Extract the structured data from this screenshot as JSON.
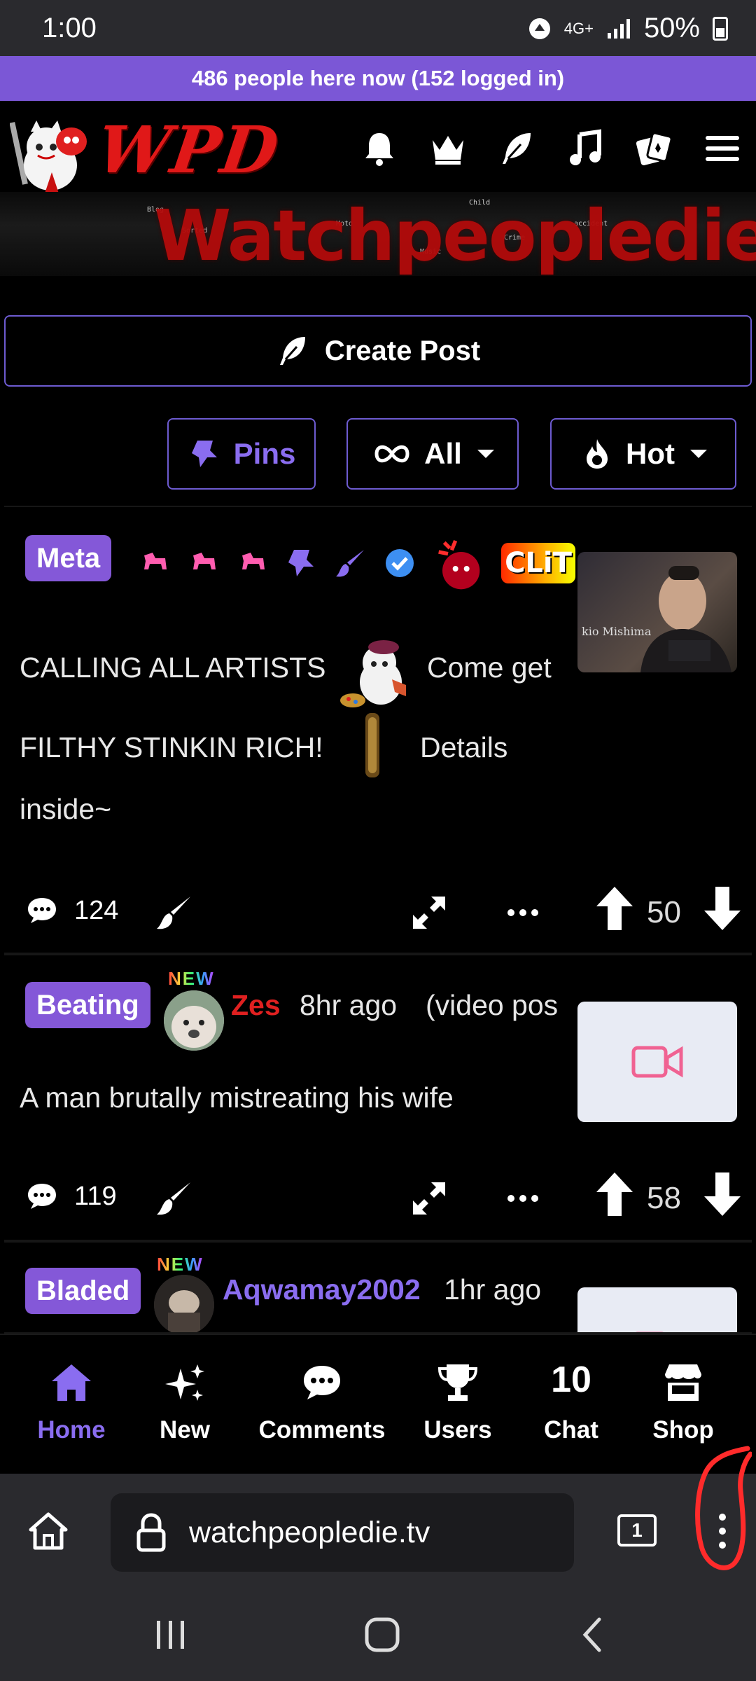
{
  "status_bar": {
    "time": "1:00",
    "network": "4G+",
    "battery": "50%"
  },
  "online_banner": "486 people here now (152 logged in)",
  "header": {
    "logo_text": "WPD",
    "banner_title": "Watchpeopledie"
  },
  "create_post_label": "Create Post",
  "filters": {
    "pins_label": "Pins",
    "all_label": "All",
    "hot_label": "Hot"
  },
  "posts": [
    {
      "flair": "Meta",
      "badge_text": "CLiT",
      "title_part1": "CALLING ALL ARTISTS",
      "title_part2": "Come get",
      "title_part3": "FILTHY STINKIN RICH!",
      "title_part4": "Details",
      "title_part5": "inside~",
      "thumbnail_caption": "kio Mishima",
      "comments": "124",
      "score": "50"
    },
    {
      "flair": "Beating",
      "new_tag": "NEW",
      "username": "Zes",
      "time_ago": "8hr ago",
      "post_type": "(video pos",
      "title": "A man brutally mistreating his wife",
      "comments": "119",
      "score": "58"
    },
    {
      "flair": "Bladed",
      "new_tag": "NEW",
      "username": "Aqwamay2002",
      "time_ago": "1hr ago"
    }
  ],
  "bottom_nav": {
    "home": "Home",
    "new": "New",
    "comments": "Comments",
    "users": "Users",
    "chat_count": "10",
    "chat": "Chat",
    "shop": "Shop"
  },
  "browser": {
    "url": "watchpeopledie.tv",
    "tab_count": "1"
  },
  "colors": {
    "accent": "#8458d8",
    "banner": "#7b57d6",
    "border": "#6d5bd0",
    "username_red": "#e02020",
    "username_purple": "#8a6df0",
    "annotation": "#ff2b2b"
  }
}
